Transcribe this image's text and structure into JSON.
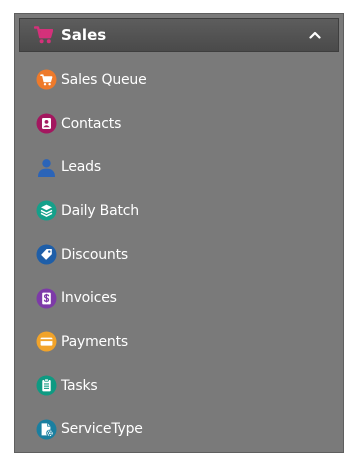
{
  "header": {
    "title": "Sales",
    "icon": "shopping-cart-icon",
    "icon_color": "#d4317a",
    "chevron": "chevron-up-icon"
  },
  "menu": {
    "items": [
      {
        "label": "Sales Queue",
        "icon": "cart-circle-icon",
        "color": "#ee7a2b"
      },
      {
        "label": "Contacts",
        "icon": "contact-card-icon",
        "color": "#a3175f"
      },
      {
        "label": "Leads",
        "icon": "person-icon",
        "color": "#2b64b8"
      },
      {
        "label": "Daily Batch",
        "icon": "layers-icon",
        "color": "#15a08a"
      },
      {
        "label": "Discounts",
        "icon": "tag-icon",
        "color": "#1e5ea8"
      },
      {
        "label": "Invoices",
        "icon": "dollar-document-icon",
        "color": "#7d3aa8"
      },
      {
        "label": "Payments",
        "icon": "credit-card-icon",
        "color": "#f1a32a"
      },
      {
        "label": "Tasks",
        "icon": "clipboard-icon",
        "color": "#0e9a82"
      },
      {
        "label": "ServiceType",
        "icon": "document-gear-icon",
        "color": "#1a7fa0"
      }
    ]
  }
}
